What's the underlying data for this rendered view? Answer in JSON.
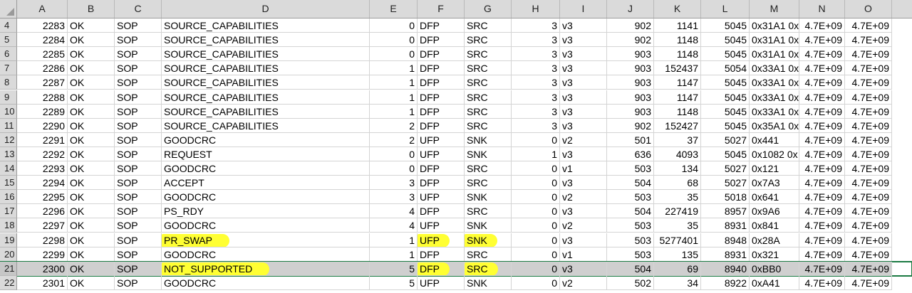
{
  "columns": [
    "A",
    "B",
    "C",
    "D",
    "E",
    "F",
    "G",
    "H",
    "I",
    "J",
    "K",
    "L",
    "M",
    "N",
    "O"
  ],
  "rows": [
    {
      "n": "4",
      "a": "2283",
      "b": "OK",
      "c": "SOP",
      "d": "SOURCE_CAPABILITIES",
      "e": "0",
      "f": "DFP",
      "g": "SRC",
      "h": "3",
      "i": "v3",
      "j": "902",
      "k": "1141",
      "l": "5045",
      "m": "0x31A1 0x",
      "nn": "4.7E+09",
      "o": "4.7E+09"
    },
    {
      "n": "5",
      "a": "2284",
      "b": "OK",
      "c": "SOP",
      "d": "SOURCE_CAPABILITIES",
      "e": "0",
      "f": "DFP",
      "g": "SRC",
      "h": "3",
      "i": "v3",
      "j": "902",
      "k": "1148",
      "l": "5045",
      "m": "0x31A1 0x",
      "nn": "4.7E+09",
      "o": "4.7E+09"
    },
    {
      "n": "6",
      "a": "2285",
      "b": "OK",
      "c": "SOP",
      "d": "SOURCE_CAPABILITIES",
      "e": "0",
      "f": "DFP",
      "g": "SRC",
      "h": "3",
      "i": "v3",
      "j": "903",
      "k": "1148",
      "l": "5045",
      "m": "0x31A1 0x",
      "nn": "4.7E+09",
      "o": "4.7E+09"
    },
    {
      "n": "7",
      "a": "2286",
      "b": "OK",
      "c": "SOP",
      "d": "SOURCE_CAPABILITIES",
      "e": "1",
      "f": "DFP",
      "g": "SRC",
      "h": "3",
      "i": "v3",
      "j": "903",
      "k": "152437",
      "l": "5054",
      "m": "0x33A1 0x",
      "nn": "4.7E+09",
      "o": "4.7E+09"
    },
    {
      "n": "8",
      "a": "2287",
      "b": "OK",
      "c": "SOP",
      "d": "SOURCE_CAPABILITIES",
      "e": "1",
      "f": "DFP",
      "g": "SRC",
      "h": "3",
      "i": "v3",
      "j": "903",
      "k": "1147",
      "l": "5045",
      "m": "0x33A1 0x",
      "nn": "4.7E+09",
      "o": "4.7E+09"
    },
    {
      "n": "9",
      "a": "2288",
      "b": "OK",
      "c": "SOP",
      "d": "SOURCE_CAPABILITIES",
      "e": "1",
      "f": "DFP",
      "g": "SRC",
      "h": "3",
      "i": "v3",
      "j": "903",
      "k": "1147",
      "l": "5045",
      "m": "0x33A1 0x",
      "nn": "4.7E+09",
      "o": "4.7E+09"
    },
    {
      "n": "10",
      "a": "2289",
      "b": "OK",
      "c": "SOP",
      "d": "SOURCE_CAPABILITIES",
      "e": "1",
      "f": "DFP",
      "g": "SRC",
      "h": "3",
      "i": "v3",
      "j": "903",
      "k": "1148",
      "l": "5045",
      "m": "0x33A1 0x",
      "nn": "4.7E+09",
      "o": "4.7E+09"
    },
    {
      "n": "11",
      "a": "2290",
      "b": "OK",
      "c": "SOP",
      "d": "SOURCE_CAPABILITIES",
      "e": "2",
      "f": "DFP",
      "g": "SRC",
      "h": "3",
      "i": "v3",
      "j": "902",
      "k": "152427",
      "l": "5045",
      "m": "0x35A1 0x",
      "nn": "4.7E+09",
      "o": "4.7E+09"
    },
    {
      "n": "12",
      "a": "2291",
      "b": "OK",
      "c": "SOP",
      "d": "GOODCRC",
      "e": "2",
      "f": "UFP",
      "g": "SNK",
      "h": "0",
      "i": "v2",
      "j": "501",
      "k": "37",
      "l": "5027",
      "m": "0x441",
      "nn": "4.7E+09",
      "o": "4.7E+09"
    },
    {
      "n": "13",
      "a": "2292",
      "b": "OK",
      "c": "SOP",
      "d": "REQUEST",
      "e": "0",
      "f": "UFP",
      "g": "SNK",
      "h": "1",
      "i": "v3",
      "j": "636",
      "k": "4093",
      "l": "5045",
      "m": "0x1082 0x",
      "nn": "4.7E+09",
      "o": "4.7E+09"
    },
    {
      "n": "14",
      "a": "2293",
      "b": "OK",
      "c": "SOP",
      "d": "GOODCRC",
      "e": "0",
      "f": "DFP",
      "g": "SRC",
      "h": "0",
      "i": "v1",
      "j": "503",
      "k": "134",
      "l": "5027",
      "m": "0x121",
      "nn": "4.7E+09",
      "o": "4.7E+09"
    },
    {
      "n": "15",
      "a": "2294",
      "b": "OK",
      "c": "SOP",
      "d": "ACCEPT",
      "e": "3",
      "f": "DFP",
      "g": "SRC",
      "h": "0",
      "i": "v3",
      "j": "504",
      "k": "68",
      "l": "5027",
      "m": "0x7A3",
      "nn": "4.7E+09",
      "o": "4.7E+09"
    },
    {
      "n": "16",
      "a": "2295",
      "b": "OK",
      "c": "SOP",
      "d": "GOODCRC",
      "e": "3",
      "f": "UFP",
      "g": "SNK",
      "h": "0",
      "i": "v2",
      "j": "503",
      "k": "35",
      "l": "5018",
      "m": "0x641",
      "nn": "4.7E+09",
      "o": "4.7E+09"
    },
    {
      "n": "17",
      "a": "2296",
      "b": "OK",
      "c": "SOP",
      "d": "PS_RDY",
      "e": "4",
      "f": "DFP",
      "g": "SRC",
      "h": "0",
      "i": "v3",
      "j": "504",
      "k": "227419",
      "l": "8957",
      "m": "0x9A6",
      "nn": "4.7E+09",
      "o": "4.7E+09"
    },
    {
      "n": "18",
      "a": "2297",
      "b": "OK",
      "c": "SOP",
      "d": "GOODCRC",
      "e": "4",
      "f": "UFP",
      "g": "SNK",
      "h": "0",
      "i": "v2",
      "j": "503",
      "k": "35",
      "l": "8931",
      "m": "0x841",
      "nn": "4.7E+09",
      "o": "4.7E+09"
    },
    {
      "n": "19",
      "a": "2298",
      "b": "OK",
      "c": "SOP",
      "d": "PR_SWAP",
      "e": "1",
      "f": "UFP",
      "g": "SNK",
      "h": "0",
      "i": "v3",
      "j": "503",
      "k": "5277401",
      "l": "8948",
      "m": "0x28A",
      "nn": "4.7E+09",
      "o": "4.7E+09",
      "highlight": true
    },
    {
      "n": "20",
      "a": "2299",
      "b": "OK",
      "c": "SOP",
      "d": "GOODCRC",
      "e": "1",
      "f": "DFP",
      "g": "SRC",
      "h": "0",
      "i": "v1",
      "j": "503",
      "k": "135",
      "l": "8931",
      "m": "0x321",
      "nn": "4.7E+09",
      "o": "4.7E+09"
    },
    {
      "n": "21",
      "a": "2300",
      "b": "OK",
      "c": "SOP",
      "d": "NOT_SUPPORTED",
      "e": "5",
      "f": "DFP",
      "g": "SRC",
      "h": "0",
      "i": "v3",
      "j": "504",
      "k": "69",
      "l": "8940",
      "m": "0xBB0",
      "nn": "4.7E+09",
      "o": "4.7E+09",
      "highlight": true,
      "selected": true
    },
    {
      "n": "22",
      "a": "2301",
      "b": "OK",
      "c": "SOP",
      "d": "GOODCRC",
      "e": "5",
      "f": "UFP",
      "g": "SNK",
      "h": "0",
      "i": "v2",
      "j": "502",
      "k": "34",
      "l": "8922",
      "m": "0xA41",
      "nn": "4.7E+09",
      "o": "4.7E+09"
    }
  ],
  "colors": {
    "highlight": "#ffff33",
    "selection_border": "#1a7a42",
    "header_bg": "#dadada"
  }
}
